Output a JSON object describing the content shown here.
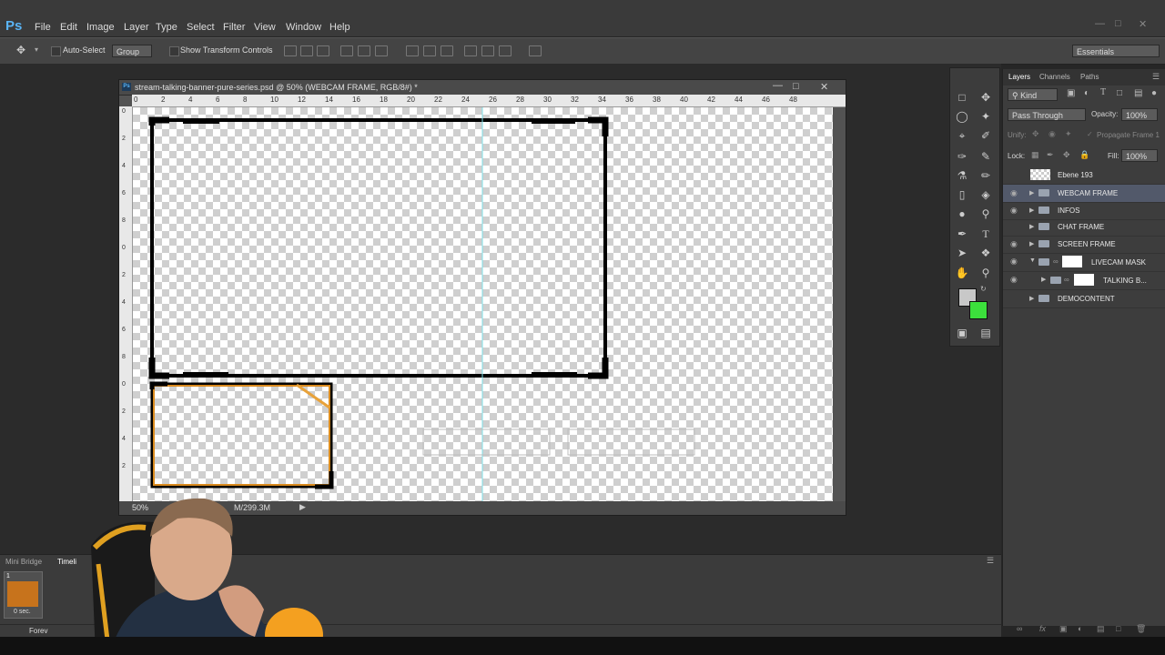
{
  "app": {
    "logo": "Ps"
  },
  "menu": [
    "File",
    "Edit",
    "Image",
    "Layer",
    "Type",
    "Select",
    "Filter",
    "View",
    "Window",
    "Help"
  ],
  "options": {
    "auto_select": "Auto-Select",
    "group": "Group",
    "show_transform": "Show Transform Controls",
    "workspace": "Essentials"
  },
  "document": {
    "title": "stream-talking-banner-pure-series.psd @ 50% (WEBCAM FRAME, RGB/8#) *",
    "zoom": "50%",
    "docsize": "M/299.3M",
    "hruler": [
      "0",
      "2",
      "4",
      "6",
      "8",
      "10",
      "12",
      "14",
      "16",
      "18",
      "20",
      "22",
      "24",
      "26",
      "28",
      "30",
      "32",
      "34",
      "36",
      "38",
      "40",
      "42",
      "44",
      "46",
      "48"
    ],
    "vruler": [
      "0",
      "2",
      "4",
      "6",
      "8",
      "0",
      "2",
      "4",
      "6",
      "8",
      "0",
      "2",
      "4",
      "2"
    ]
  },
  "layers_panel": {
    "tabs": [
      "Layers",
      "Channels",
      "Paths"
    ],
    "kind": "Kind",
    "blend": "Pass Through",
    "opacity_label": "Opacity:",
    "opacity": "100%",
    "unify": "Unify:",
    "propagate": "Propagate Frame 1",
    "lock": "Lock:",
    "fill_label": "Fill:",
    "fill": "100%",
    "layers": [
      {
        "name": "Ebene 193"
      },
      {
        "name": "WEBCAM FRAME"
      },
      {
        "name": "INFOS"
      },
      {
        "name": "CHAT FRAME"
      },
      {
        "name": "SCREEN FRAME"
      },
      {
        "name": "LIVECAM MASK"
      },
      {
        "name": "TALKING B..."
      },
      {
        "name": "DEMOCONTENT"
      }
    ]
  },
  "bottom": {
    "tab1": "Mini Bridge",
    "tab2": "Timeli",
    "frame_num": "1",
    "frame_time": "0 sec.",
    "forever": "Forev"
  },
  "colors": {
    "foreground": "#c8c8c8",
    "background": "#3ce03c",
    "accent": "#5ab4f5"
  }
}
